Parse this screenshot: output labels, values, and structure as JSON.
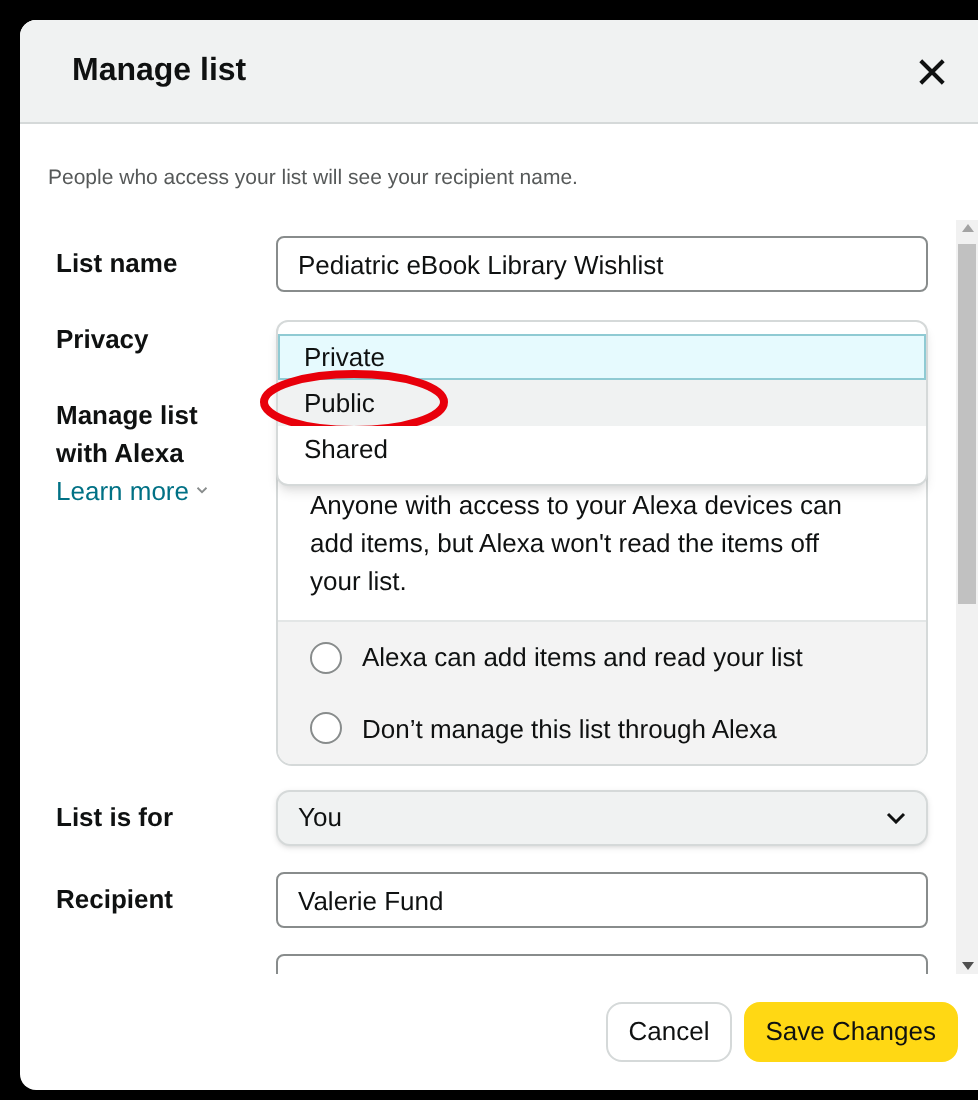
{
  "dialog": {
    "title": "Manage list"
  },
  "note": "People who access your list will see your recipient name.",
  "list_name": {
    "label": "List name",
    "value": "Pediatric eBook Library Wishlist"
  },
  "privacy": {
    "label": "Privacy",
    "options": [
      {
        "label": "Private",
        "selected": true,
        "hovered": false
      },
      {
        "label": "Public",
        "selected": false,
        "hovered": true,
        "circled": true
      },
      {
        "label": "Shared",
        "selected": false,
        "hovered": false
      }
    ]
  },
  "alexa": {
    "label": "Manage list with Alexa",
    "learn_more": "Learn more",
    "description": "Anyone with access to your Alexa devices can add items, but Alexa won't read the items off your list.",
    "options": [
      {
        "label": "Alexa can add items and read your list",
        "selected": false
      },
      {
        "label": "Don’t manage this list through Alexa",
        "selected": false
      }
    ]
  },
  "list_for": {
    "label": "List is for",
    "value": "You"
  },
  "recipient": {
    "label": "Recipient",
    "value": "Valerie Fund"
  },
  "buttons": [
    {
      "kind": "secondary",
      "label": "Cancel"
    },
    {
      "kind": "primary",
      "label": "Save Changes"
    }
  ]
}
